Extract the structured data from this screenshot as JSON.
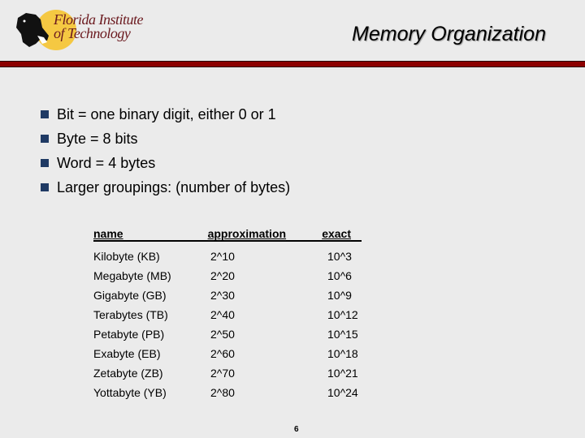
{
  "header": {
    "logo_line1": "Florida Institute",
    "logo_line2": "of Technology",
    "title": "Memory Organization",
    "accent_bar_color": "#8c0000"
  },
  "bullets": [
    "Bit = one binary digit, either 0 or 1",
    "Byte = 8 bits",
    "Word = 4 bytes",
    "Larger groupings: (number of bytes)"
  ],
  "table": {
    "columns": [
      "name",
      "approximation",
      "exact"
    ],
    "rows": [
      [
        "Kilobyte (KB)",
        "2^10",
        "10^3"
      ],
      [
        "Megabyte (MB)",
        "2^20",
        "10^6"
      ],
      [
        "Gigabyte (GB)",
        "2^30",
        "10^9"
      ],
      [
        "Terabytes (TB)",
        "2^40",
        "10^12"
      ],
      [
        "Petabyte (PB)",
        "2^50",
        "10^15"
      ],
      [
        "Exabyte (EB)",
        "2^60",
        "10^18"
      ],
      [
        "Zetabyte (ZB)",
        "2^70",
        "10^21"
      ],
      [
        "Yottabyte (YB)",
        "2^80",
        "10^24"
      ]
    ]
  },
  "footer": {
    "page_number": "6"
  }
}
